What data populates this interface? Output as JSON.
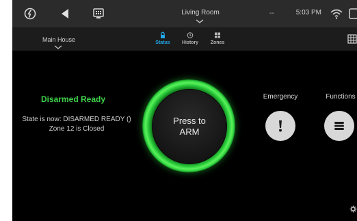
{
  "topbar": {
    "room": "Living Room",
    "dash": "--",
    "time": "5:03 PM",
    "icons": [
      "logo-icon",
      "back-arrow-icon",
      "home-panel-icon",
      "chevron-down-icon",
      "wifi-icon",
      "panel-icon"
    ]
  },
  "subnav": {
    "location": "Main House",
    "tabs": [
      {
        "label": "Status",
        "icon": "lock-icon",
        "active": true
      },
      {
        "label": "History",
        "icon": "clock-icon",
        "active": false
      },
      {
        "label": "Zones",
        "icon": "grid-icon",
        "active": false
      }
    ],
    "icons": [
      "chevron-down-icon",
      "keypad-icon"
    ]
  },
  "status": {
    "title": "Disarmed Ready",
    "state_line": "State is now: DISARMED READY ()",
    "zone_line": "Zone 12 is Closed"
  },
  "arm_button": {
    "label_line1": "Press to",
    "label_line2": "ARM"
  },
  "actions": {
    "emergency_label": "Emergency",
    "functions_label": "Functions",
    "icons": [
      "exclamation-icon",
      "menu-lines-icon",
      "settings-icon"
    ]
  },
  "colors": {
    "accent_blue": "#22a8e8",
    "ready_green": "#3ed24a",
    "ring_green": "#2fd33f",
    "topbar_bg": "#2b2b2b",
    "subnav_bg": "#1c1c1c",
    "screen_bg": "#000000"
  }
}
